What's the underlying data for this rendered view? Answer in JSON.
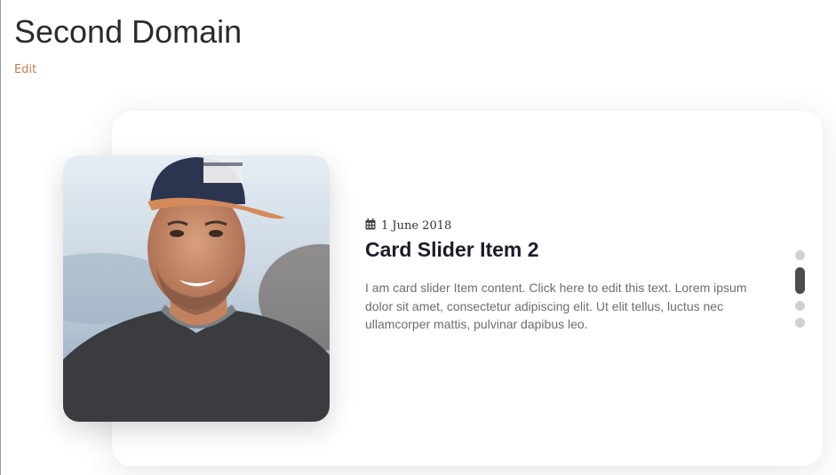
{
  "page": {
    "title": "Second Domain",
    "edit_label": "Edit"
  },
  "slider": {
    "active_index": 1,
    "slide_count": 4,
    "item": {
      "date": "1 June 2018",
      "date_icon": "calendar-icon",
      "title": "Card Slider Item 2",
      "text": "I am card slider Item content. Click here to edit this text. Lorem ipsum dolor sit amet, consectetur adipiscing elit. Ut elit tellus, luctus nec ullamcorper mattis, pulvinar dapibus leo.",
      "image": "portrait-photo"
    }
  },
  "colors": {
    "link": "#c77b4a",
    "title": "#1c1c2a",
    "body_text": "#6d6d6d",
    "dot_active": "#4d4d4f",
    "dot_inactive": "#cfcfd3"
  }
}
